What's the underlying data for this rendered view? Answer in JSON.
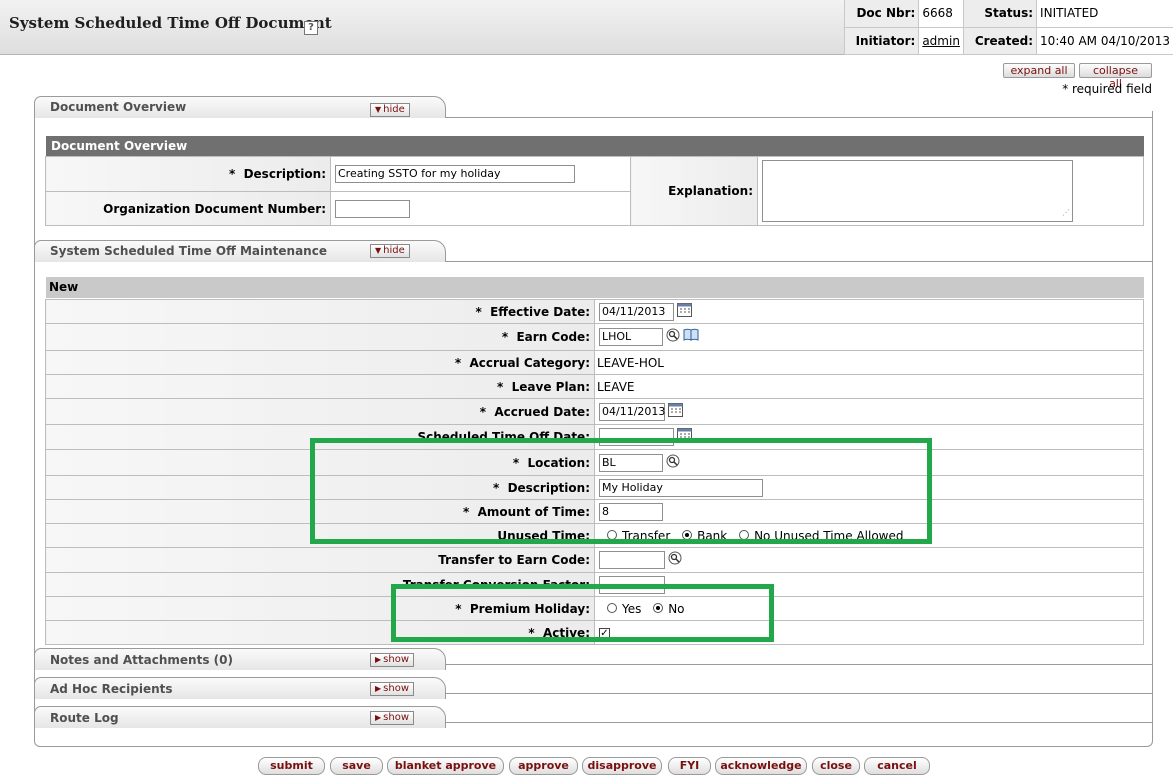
{
  "header": {
    "title": "System Scheduled Time Off Document",
    "help_icon": "?",
    "doc_nbr_label": "Doc Nbr:",
    "doc_nbr": "6668",
    "status_label": "Status:",
    "status": "INITIATED",
    "initiator_label": "Initiator:",
    "initiator": "admin",
    "created_label": "Created:",
    "created": "10:40 AM 04/10/2013"
  },
  "controls": {
    "expand_all": "expand all",
    "collapse_all": "collapse all",
    "required_note": "* required field"
  },
  "tabs": {
    "document_overview": {
      "title": "Document Overview",
      "toggle": "hide"
    },
    "maintenance": {
      "title": "System Scheduled Time Off Maintenance",
      "toggle": "hide"
    },
    "notes": {
      "title": "Notes and Attachments (0)",
      "toggle": "show"
    },
    "adhoc": {
      "title": "Ad Hoc Recipients",
      "toggle": "show"
    },
    "route_log": {
      "title": "Route Log",
      "toggle": "show"
    }
  },
  "overview": {
    "section_title": "Document Overview",
    "description_label": "Description:",
    "description_value": "Creating SSTO for my holiday",
    "org_doc_label": "Organization Document Number:",
    "org_doc_value": "",
    "explanation_label": "Explanation:",
    "explanation_value": ""
  },
  "maintenance": {
    "section_title": "New",
    "req": "*",
    "effective_date_label": "Effective Date:",
    "effective_date": "04/11/2013",
    "earn_code_label": "Earn Code:",
    "earn_code": "LHOL",
    "accrual_category_label": "Accrual Category:",
    "accrual_category": "LEAVE-HOL",
    "leave_plan_label": "Leave Plan:",
    "leave_plan": "LEAVE",
    "accrued_date_label": "Accrued Date:",
    "accrued_date": "04/11/2013",
    "sched_time_off_label": "Scheduled Time Off Date:",
    "sched_time_off": "",
    "location_label": "Location:",
    "location": "BL",
    "description_label": "Description:",
    "description": "My Holiday",
    "amount_label": "Amount of Time:",
    "amount": "8",
    "unused_time_label": "Unused Time:",
    "unused_options": [
      "Transfer",
      "Bank",
      "No Unused Time Allowed"
    ],
    "unused_selected": "Bank",
    "transfer_earn_code_label": "Transfer to Earn Code:",
    "transfer_earn_code": "",
    "transfer_factor_label": "Transfer Conversion Factor:",
    "transfer_factor": "",
    "premium_holiday_label": "Premium Holiday:",
    "premium_options": [
      "Yes",
      "No"
    ],
    "premium_selected": "No",
    "active_label": "Active:",
    "active": true
  },
  "buttons": [
    "submit",
    "save",
    "blanket approve",
    "approve",
    "disapprove",
    "FYI",
    "acknowledge",
    "close",
    "cancel"
  ],
  "colors": {
    "highlight": "#22a84a",
    "button_text": "#7a0f0f",
    "section_header": "#707070"
  }
}
